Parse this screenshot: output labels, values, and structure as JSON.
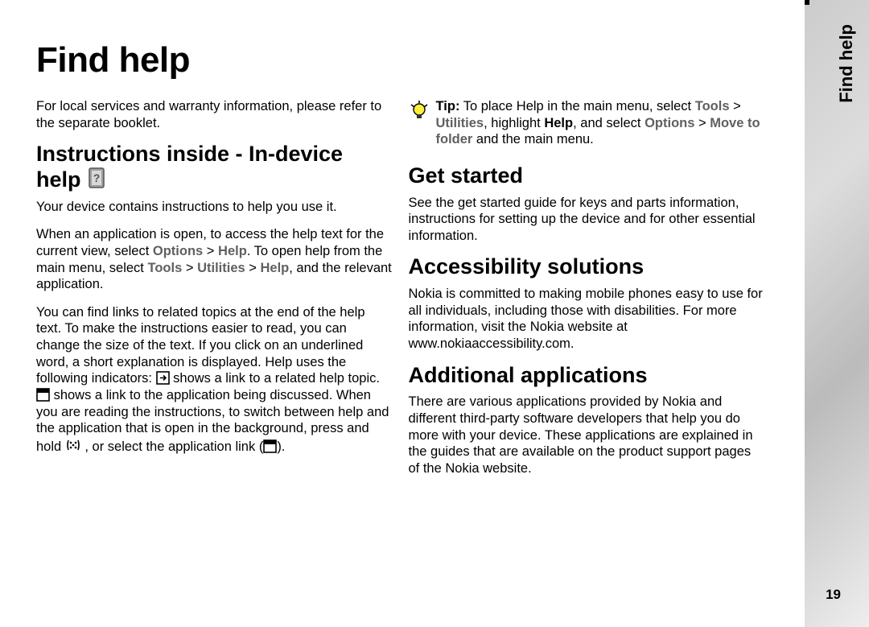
{
  "sideTab": "Find help",
  "title": "Find help",
  "intro": "For local services and warranty information, please refer to the separate booklet.",
  "section_indevice": {
    "heading_a": "Instructions inside - In-device help",
    "p1": "Your device contains instructions to help you use it.",
    "p2_a": "When an application is open, to access the help text for the current view, select ",
    "p2_opt": "Options",
    "p2_gt1": " > ",
    "p2_help": "Help",
    "p2_b": ". To open help from the main menu, select ",
    "p2_tools": "Tools",
    "p2_gt2": " > ",
    "p2_util": "Utilities",
    "p2_gt3": " > ",
    "p2_help2": "Help",
    "p2_c": ", and the relevant application.",
    "p3_a": "You can find links to related topics at the end of the help text. To make the instructions easier to read, you can change the size of the text. If you click on an underlined word, a short explanation is displayed. Help uses the following indicators: ",
    "p3_b": " shows a link to a related help topic. ",
    "p3_c": " shows a link to the application being discussed. When you are reading the instructions, to switch between help and the application that is open in the background, press and hold ",
    "p3_d": " , or select the application link (",
    "p3_e": ")."
  },
  "tip": {
    "lead": "Tip:",
    "a": "  To place Help in the main menu, select ",
    "tools": "Tools",
    "gt1": " > ",
    "util": "Utilities",
    "b": ", highlight ",
    "help": "Help",
    "c": ", and select ",
    "opt": "Options",
    "gt2": " > ",
    "move": "Move to folder",
    "d": " and the main menu."
  },
  "section_get": {
    "heading": "Get started",
    "p": "See the get started guide for keys and parts information, instructions for setting up the device and for other essential information."
  },
  "section_acc": {
    "heading": "Accessibility solutions",
    "p": "Nokia is committed to making mobile phones easy to use for all individuals, including those with disabilities. For more information, visit the Nokia website at www.nokiaaccessibility.com."
  },
  "section_add": {
    "heading": "Additional applications",
    "p": "There are various applications provided by Nokia and different third-party software developers that help you do more with your device. These applications are explained in the guides that are available on the product support pages of the Nokia website."
  },
  "pageNumber": "19"
}
